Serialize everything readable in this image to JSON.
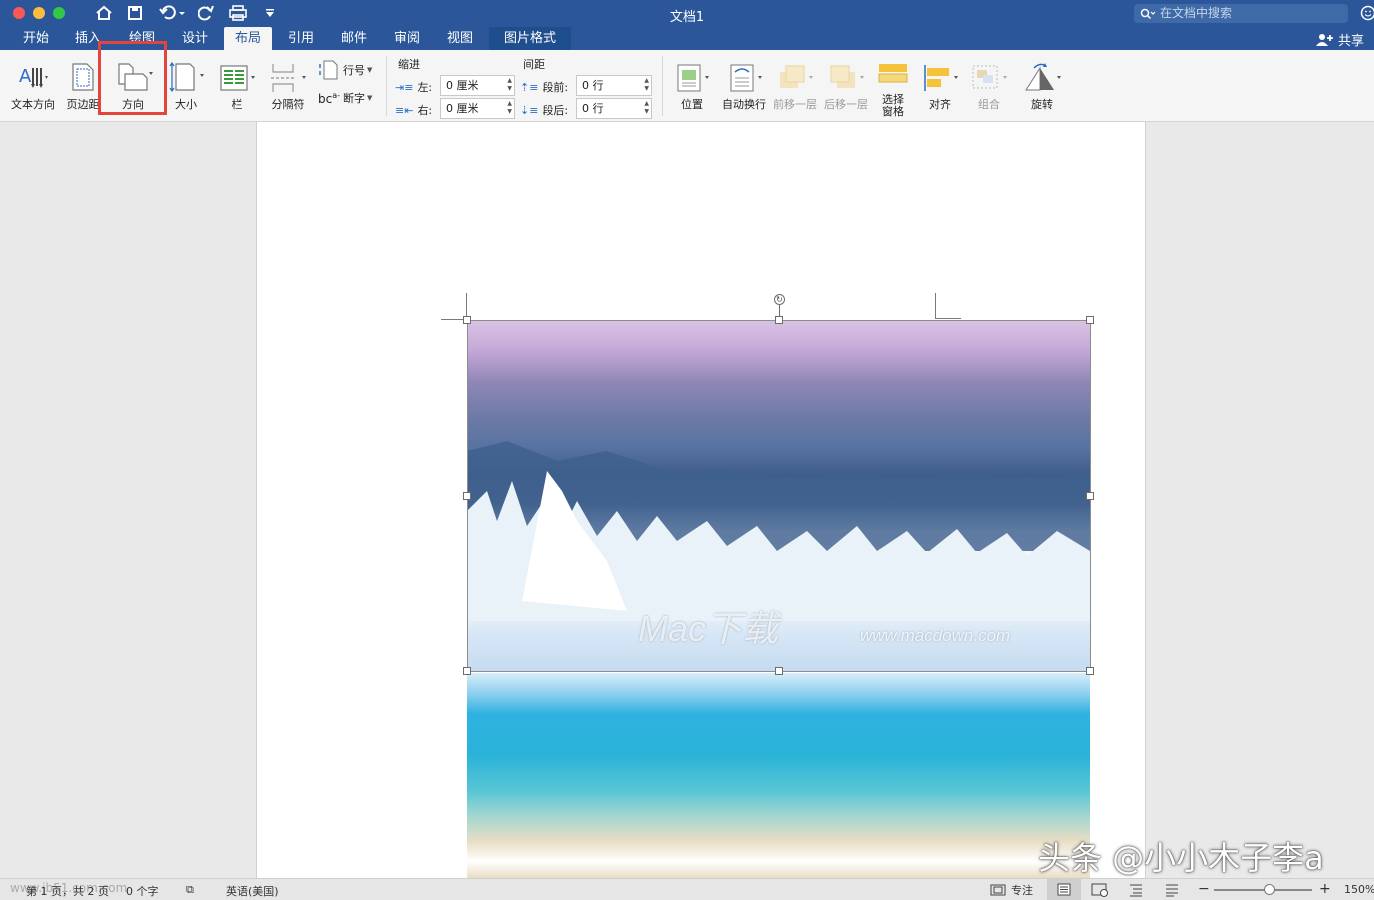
{
  "window": {
    "title": "文档1"
  },
  "search": {
    "placeholder": "在文档中搜索"
  },
  "tabs": [
    "开始",
    "插入",
    "绘图",
    "设计",
    "布局",
    "引用",
    "邮件",
    "审阅",
    "视图",
    "图片格式"
  ],
  "active_tab": "布局",
  "share_label": "共享",
  "ribbon": {
    "text_direction": "文本方向",
    "margins": "页边距",
    "orientation": "方向",
    "size": "大小",
    "columns": "栏",
    "breaks": "分隔符",
    "line_numbers": "行号",
    "hyphenation": "断字",
    "indent": {
      "title": "缩进",
      "left_label": "左:",
      "left_value": "0 厘米",
      "right_label": "右:",
      "right_value": "0 厘米"
    },
    "spacing": {
      "title": "间距",
      "before_label": "段前:",
      "before_value": "0 行",
      "after_label": "段后:",
      "after_value": "0 行"
    },
    "position": "位置",
    "wrap_text": "自动换行",
    "bring_forward": "前移一层",
    "send_backward": "后移一层",
    "selection_pane_1": "选择",
    "selection_pane_2": "窗格",
    "align": "对齐",
    "group": "组合",
    "rotate": "旋转"
  },
  "image_watermark": {
    "text": "Mac下载",
    "url": "www.macdown.com"
  },
  "overlay_credit": "头条 @小小木子李a",
  "status": {
    "page": "第 1 页，共 2 页",
    "words": "0 个字",
    "language": "英语(美国)",
    "focus": "专注",
    "zoom": "150%",
    "overlay_watermark": "www.jb51.com.com"
  },
  "colors": {
    "brand": "#2b579a",
    "highlight": "#e2453c"
  }
}
